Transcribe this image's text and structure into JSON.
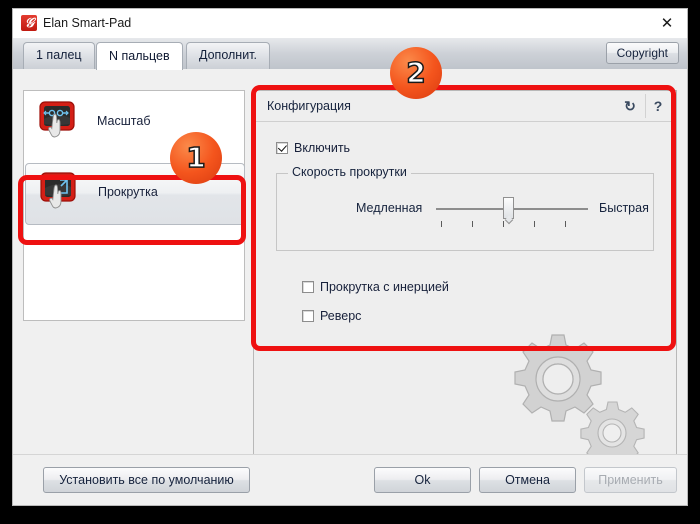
{
  "window": {
    "title": "Elan Smart-Pad",
    "app_icon": "elan-logo-icon",
    "close_icon": "✕"
  },
  "tabs": [
    {
      "label": "1 палец",
      "active": false
    },
    {
      "label": "N пальцев",
      "active": true
    },
    {
      "label": "Дополнит.",
      "active": false
    }
  ],
  "toolbar": {
    "copyright_label": "Copyright"
  },
  "sidebar": {
    "items": [
      {
        "label": "Масштаб",
        "icon": "touchpad-pinch-icon",
        "selected": false
      },
      {
        "label": "Прокрутка",
        "icon": "touchpad-scroll-icon",
        "selected": true
      }
    ]
  },
  "config": {
    "title": "Конфигурация",
    "refresh_icon": "↻",
    "help_icon": "?",
    "enable_checkbox": {
      "label": "Включить",
      "checked": true
    },
    "group": {
      "label": "Скорость прокрутки",
      "slow_label": "Медленная",
      "fast_label": "Быстрая",
      "tick_count": 5,
      "value_percent": 50
    },
    "options": [
      {
        "label": "Прокрутка с инерцией",
        "checked": false
      },
      {
        "label": "Реверс",
        "checked": false
      }
    ]
  },
  "footer": {
    "defaults_label": "Установить все по умолчанию",
    "ok_label": "Ok",
    "cancel_label": "Отмена",
    "apply_label": "Применить",
    "apply_disabled": true
  },
  "annotations": {
    "badge_1": "1",
    "badge_2": "2",
    "highlight_color": "#ee1111"
  }
}
